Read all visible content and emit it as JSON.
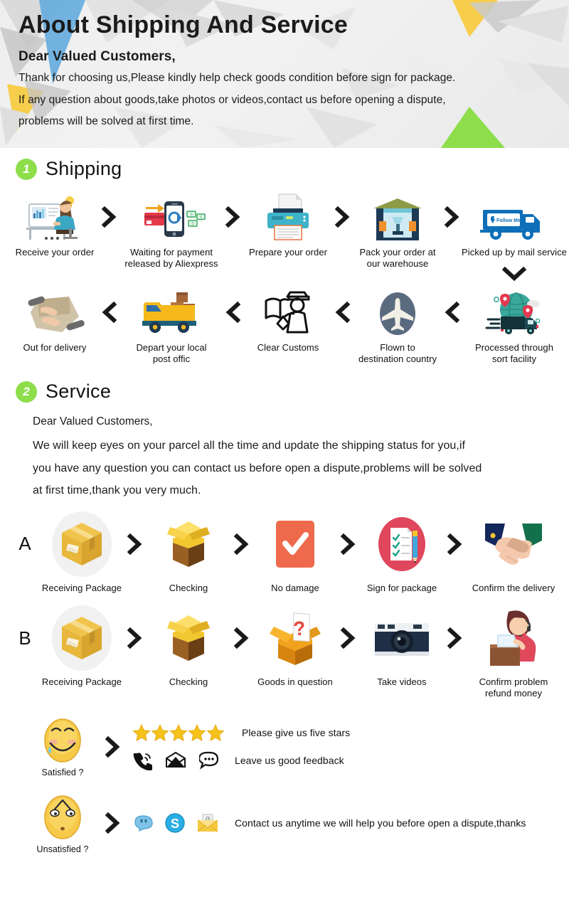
{
  "header": {
    "title": "About Shipping And Service",
    "greeting": "Dear Valued Customers,",
    "line1": "Thank for choosing us,Please kindly help check goods condition before sign for package.",
    "line2": "If any question about goods,take photos or videos,contact us before opening a dispute,",
    "line3": "problems will be solved at first time.",
    "colors": {
      "blue_triangle": "#6aaede",
      "yellow_triangle": "#f7ce4b",
      "green_triangle": "#8ede4c",
      "grey_triangle": "#c9c9c9",
      "background": "#eeeeee"
    }
  },
  "sections": [
    {
      "number": "1",
      "title": "Shipping",
      "badge_color": "#8ede4c"
    },
    {
      "number": "2",
      "title": "Service",
      "badge_color": "#8ede4c"
    }
  ],
  "shipping": {
    "row1": [
      {
        "icon": "person-at-computer-icon",
        "label": "Receive your order"
      },
      {
        "icon": "mobile-payment-icon",
        "label": "Waiting for payment\nreleased by Aliexpress"
      },
      {
        "icon": "printer-icon",
        "label": "Prepare your order"
      },
      {
        "icon": "warehouse-icon",
        "label": "Pack your order at\nour warehouse"
      },
      {
        "icon": "delivery-truck-icon",
        "label": "Picked up by mail service",
        "truck_text": "Follow Me"
      }
    ],
    "row2": [
      {
        "icon": "package-handoff-icon",
        "label": "Out for delivery"
      },
      {
        "icon": "post-van-icon",
        "label": "Depart your local\npost offic"
      },
      {
        "icon": "customs-officer-icon",
        "label": "Clear Customs"
      },
      {
        "icon": "airplane-icon",
        "label": "Flown to\ndestination country"
      },
      {
        "icon": "globe-sort-facility-icon",
        "label": "Processed through\nsort facility"
      }
    ],
    "down_arrow": "chevron-down-icon",
    "forward_chevron": "chevron-right-icon",
    "back_chevron": "chevron-left-icon"
  },
  "service": {
    "greeting": "Dear Valued Customers,",
    "paragraph1": "We will keep eyes on your parcel all the time and update the shipping status for you,if",
    "paragraph2": "you have any question you can contact us before open a dispute,problems will be solved",
    "paragraph3": "at first time,thank you very much.",
    "rowA": {
      "label": "A",
      "steps": [
        {
          "icon": "parcel-box-icon",
          "label": "Receiving Package"
        },
        {
          "icon": "open-box-icon",
          "label": "Checking"
        },
        {
          "icon": "checkmark-icon",
          "label": "No damage"
        },
        {
          "icon": "signature-checklist-icon",
          "label": "Sign for package"
        },
        {
          "icon": "handshake-icon",
          "label": "Confirm the delivery"
        }
      ]
    },
    "rowB": {
      "label": "B",
      "steps": [
        {
          "icon": "parcel-box-icon",
          "label": "Receiving Package"
        },
        {
          "icon": "open-box-icon",
          "label": "Checking"
        },
        {
          "icon": "question-box-icon",
          "label": "Goods in question"
        },
        {
          "icon": "camera-icon",
          "label": "Take videos"
        },
        {
          "icon": "support-agent-icon",
          "label": "Confirm problem\nrefund money"
        }
      ]
    }
  },
  "feedback": {
    "satisfied": {
      "emoji": "relieved-face-icon",
      "label": "Satisfied ?",
      "line1": {
        "icon": "five-stars-icon",
        "stars": 5,
        "text": "Please give us five stars"
      },
      "line2": {
        "icons": [
          "phone-icon",
          "envelope-icon",
          "chat-bubble-icon"
        ],
        "text": "Leave us good feedback"
      }
    },
    "unsatisfied": {
      "emoji": "worried-face-icon",
      "label": "Unsatisfied ?",
      "line1": {
        "icons": [
          "messenger-icon",
          "skype-icon",
          "email-icon"
        ],
        "text": "Contact us anytime we will help you before open a dispute,thanks"
      }
    },
    "star_color": "#f4c21b"
  }
}
